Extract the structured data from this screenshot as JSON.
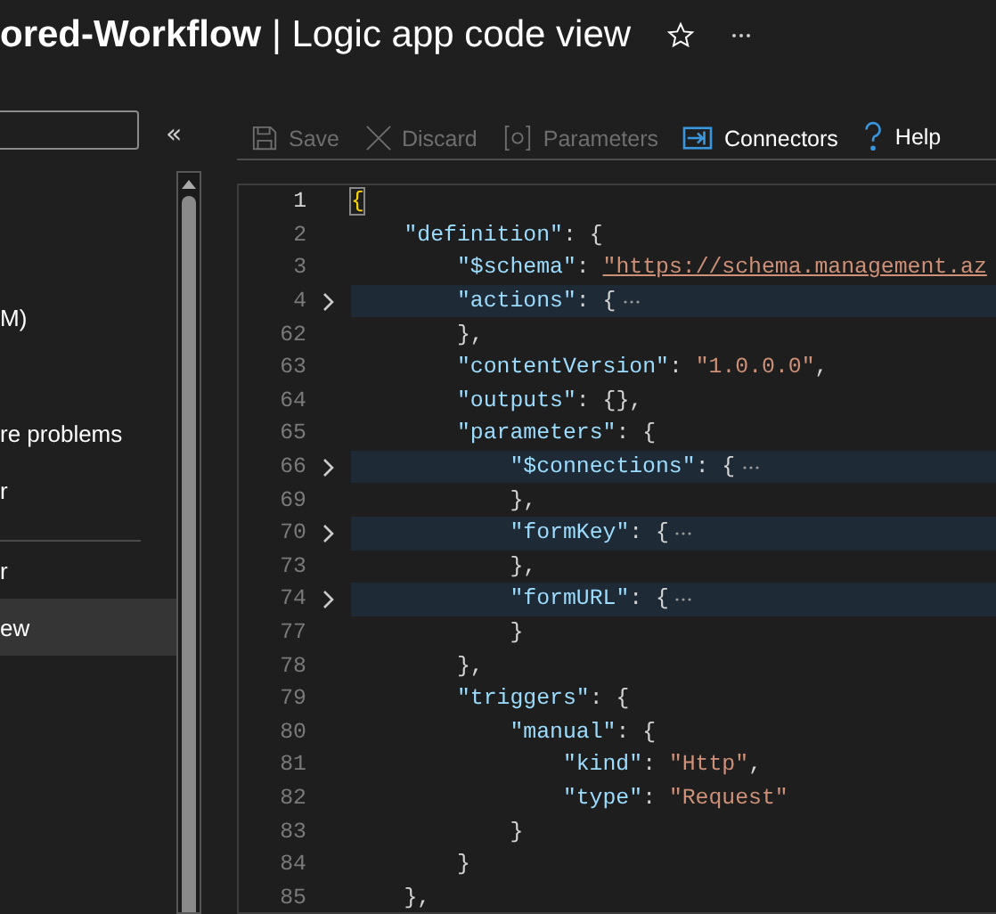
{
  "header": {
    "title": "**ored-Workflow** | Logic app code view"
  },
  "sidebar": {
    "collapse": "«",
    "items": [
      {
        "label": "M)",
        "selected": false,
        "divider_before": false
      },
      {
        "label": "re problems",
        "selected": false,
        "divider_before": false
      },
      {
        "label": "r",
        "selected": false,
        "divider_before": false
      },
      {
        "label": "r",
        "selected": false,
        "divider_before": true
      },
      {
        "label": "ew",
        "selected": true,
        "divider_before": false
      }
    ]
  },
  "toolbar": [
    {
      "label": "Save",
      "kind": "save",
      "disabled": true
    },
    {
      "label": "Discard",
      "kind": "discard",
      "disabled": true
    },
    {
      "label": "Parameters",
      "kind": "parameters",
      "disabled": true
    },
    {
      "label": "Connectors",
      "kind": "connectors",
      "disabled": false
    },
    {
      "label": "Help",
      "kind": "help",
      "disabled": false
    }
  ],
  "editor": {
    "lines": [
      {
        "number": "1",
        "current": true,
        "folded": false,
        "tokens": [
          {
            "kind": "bracket",
            "text": "{"
          }
        ],
        "children": [
          {
            "number": "2",
            "current": false,
            "folded": false,
            "tokens": [
              {
                "kind": "key",
                "text": "\"definition\""
              },
              {
                "kind": "punct",
                "text": ": {"
              }
            ],
            "children": [
              {
                "number": "3",
                "current": false,
                "folded": false,
                "tokens": [
                  {
                    "kind": "key",
                    "text": "\"$schema\""
                  },
                  {
                    "kind": "punct",
                    "text": ": "
                  },
                  {
                    "kind": "link",
                    "text": "\"https://schema.management.az"
                  }
                ]
              },
              {
                "number": "4",
                "current": false,
                "folded": true,
                "tokens": [
                  {
                    "kind": "key",
                    "text": "\"actions\""
                  },
                  {
                    "kind": "punct",
                    "text": ": {"
                  }
                ]
              },
              {
                "number": "62",
                "current": false,
                "folded": false,
                "tokens": [
                  {
                    "kind": "punct",
                    "text": "},"
                  }
                ]
              },
              {
                "number": "63",
                "current": false,
                "folded": false,
                "tokens": [
                  {
                    "kind": "key",
                    "text": "\"contentVersion\""
                  },
                  {
                    "kind": "punct",
                    "text": ": "
                  },
                  {
                    "kind": "string",
                    "text": "\"1.0.0.0\""
                  },
                  {
                    "kind": "punct",
                    "text": ","
                  }
                ]
              },
              {
                "number": "64",
                "current": false,
                "folded": false,
                "tokens": [
                  {
                    "kind": "key",
                    "text": "\"outputs\""
                  },
                  {
                    "kind": "punct",
                    "text": ": {},"
                  }
                ]
              },
              {
                "number": "65",
                "current": false,
                "folded": false,
                "tokens": [
                  {
                    "kind": "key",
                    "text": "\"parameters\""
                  },
                  {
                    "kind": "punct",
                    "text": ": {"
                  }
                ],
                "children": [
                  {
                    "number": "66",
                    "current": false,
                    "folded": true,
                    "tokens": [
                      {
                        "kind": "key",
                        "text": "\"$connections\""
                      },
                      {
                        "kind": "punct",
                        "text": ": {"
                      }
                    ]
                  },
                  {
                    "number": "69",
                    "current": false,
                    "folded": false,
                    "tokens": [
                      {
                        "kind": "punct",
                        "text": "},"
                      }
                    ]
                  },
                  {
                    "number": "70",
                    "current": false,
                    "folded": true,
                    "tokens": [
                      {
                        "kind": "key",
                        "text": "\"formKey\""
                      },
                      {
                        "kind": "punct",
                        "text": ": {"
                      }
                    ]
                  },
                  {
                    "number": "73",
                    "current": false,
                    "folded": false,
                    "tokens": [
                      {
                        "kind": "punct",
                        "text": "},"
                      }
                    ]
                  },
                  {
                    "number": "74",
                    "current": false,
                    "folded": true,
                    "tokens": [
                      {
                        "kind": "key",
                        "text": "\"formURL\""
                      },
                      {
                        "kind": "punct",
                        "text": ": {"
                      }
                    ]
                  },
                  {
                    "number": "77",
                    "current": false,
                    "folded": false,
                    "tokens": [
                      {
                        "kind": "punct",
                        "text": "}"
                      }
                    ]
                  }
                ]
              },
              {
                "number": "78",
                "current": false,
                "folded": false,
                "tokens": [
                  {
                    "kind": "punct",
                    "text": "},"
                  }
                ]
              },
              {
                "number": "79",
                "current": false,
                "folded": false,
                "tokens": [
                  {
                    "kind": "key",
                    "text": "\"triggers\""
                  },
                  {
                    "kind": "punct",
                    "text": ": {"
                  }
                ],
                "children": [
                  {
                    "number": "80",
                    "current": false,
                    "folded": false,
                    "tokens": [
                      {
                        "kind": "key",
                        "text": "\"manual\""
                      },
                      {
                        "kind": "punct",
                        "text": ": {"
                      }
                    ],
                    "children": [
                      {
                        "number": "81",
                        "current": false,
                        "folded": false,
                        "tokens": [
                          {
                            "kind": "key",
                            "text": "\"kind\""
                          },
                          {
                            "kind": "punct",
                            "text": ": "
                          },
                          {
                            "kind": "string",
                            "text": "\"Http\""
                          },
                          {
                            "kind": "punct",
                            "text": ","
                          }
                        ]
                      },
                      {
                        "number": "82",
                        "current": false,
                        "folded": false,
                        "tokens": [
                          {
                            "kind": "key",
                            "text": "\"type\""
                          },
                          {
                            "kind": "punct",
                            "text": ": "
                          },
                          {
                            "kind": "string",
                            "text": "\"Request\""
                          }
                        ]
                      }
                    ]
                  },
                  {
                    "number": "83",
                    "current": false,
                    "folded": false,
                    "tokens": [
                      {
                        "kind": "punct",
                        "text": "}"
                      }
                    ]
                  }
                ]
              },
              {
                "number": "84",
                "current": false,
                "folded": false,
                "tokens": [
                  {
                    "kind": "punct",
                    "text": "}"
                  }
                ]
              }
            ]
          },
          {
            "number": "85",
            "current": false,
            "folded": false,
            "tokens": [
              {
                "kind": "punct",
                "text": "},"
              }
            ]
          }
        ]
      }
    ]
  }
}
